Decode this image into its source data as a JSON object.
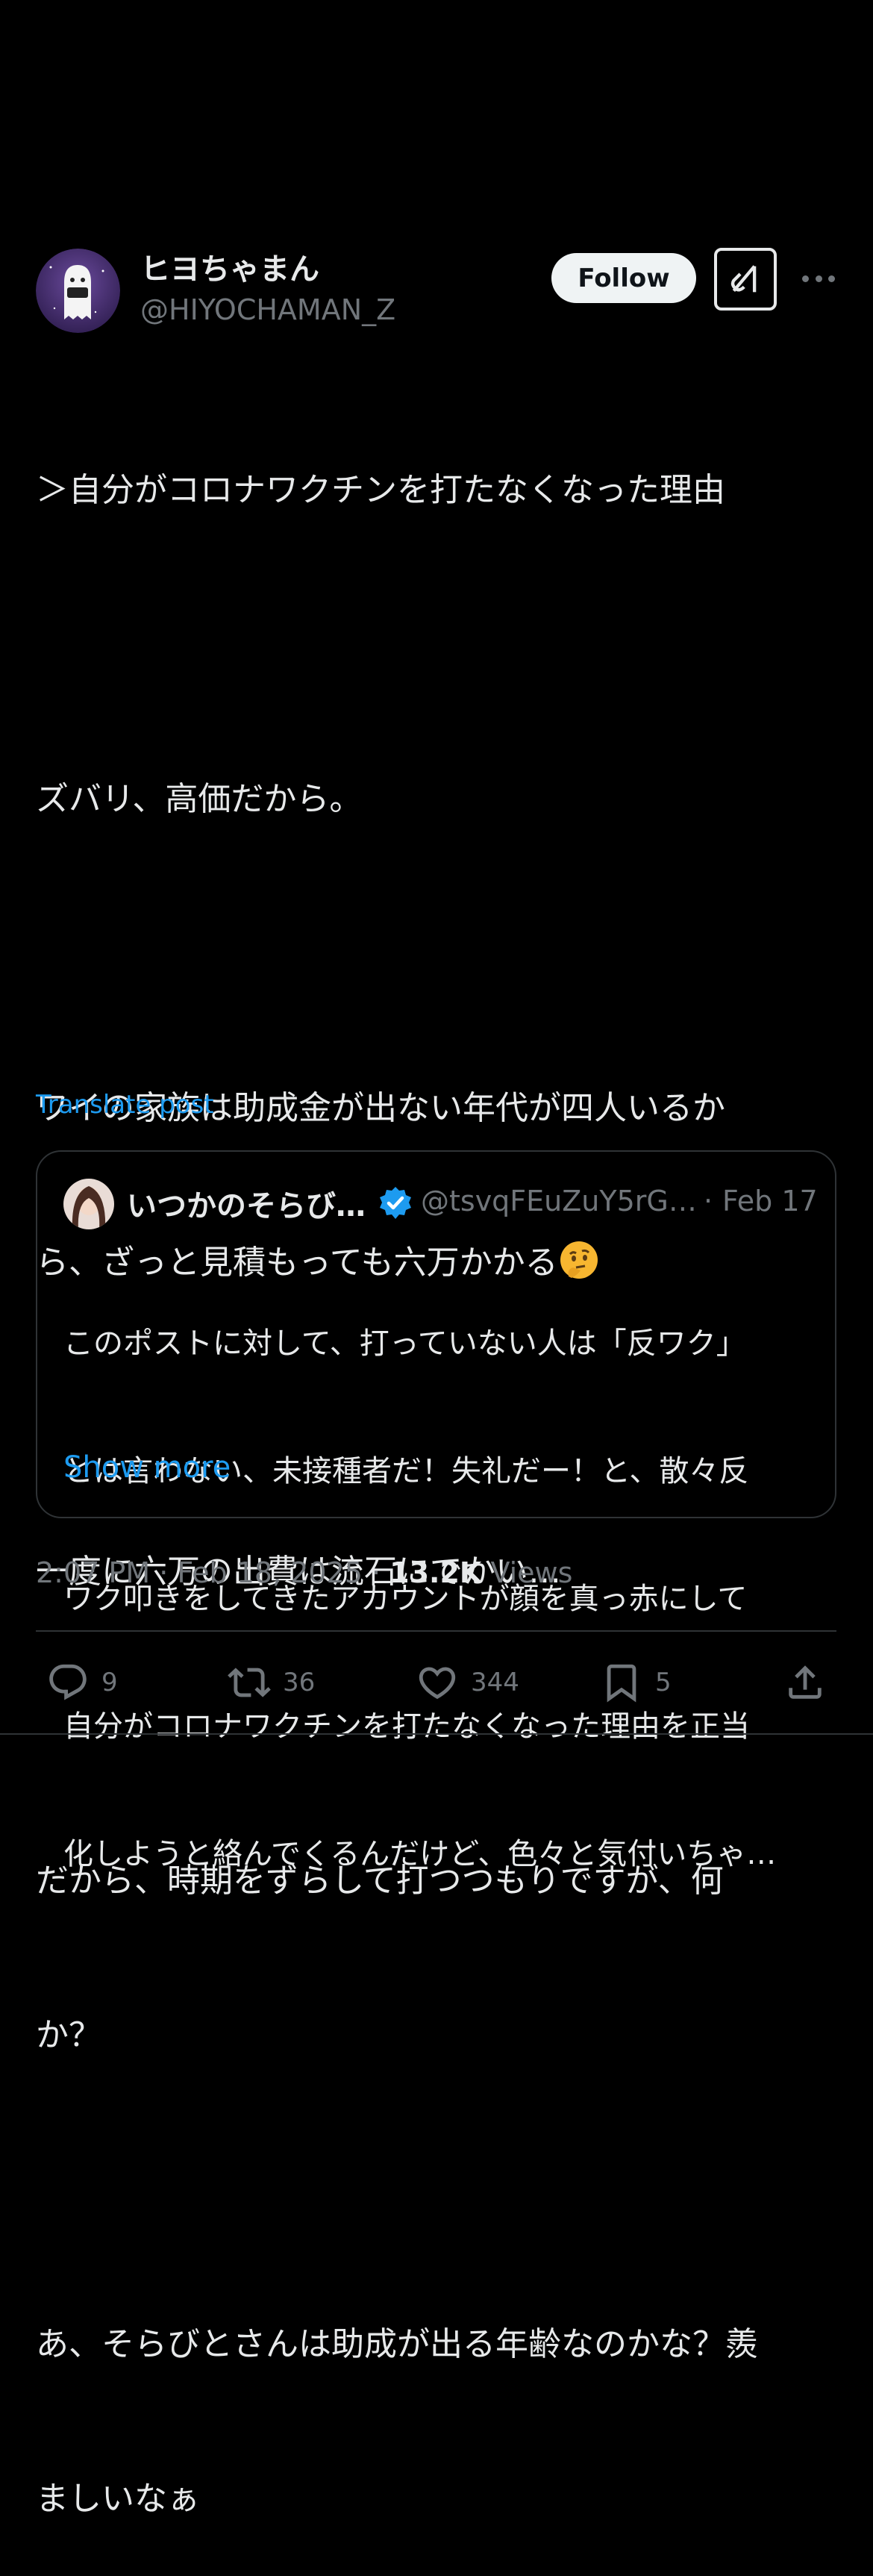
{
  "header": {
    "logo_icon": "x-logo-icon"
  },
  "author": {
    "display_name": "ヒヨちゃまん",
    "handle": "@HIYOCHAMAN_Z",
    "avatar_icon": "avatar-ghost-icon"
  },
  "actions_top": {
    "follow_label": "Follow",
    "grok_icon": "grok-icon",
    "more_icon": "more-icon"
  },
  "post": {
    "text_lines": [
      "＞自分がコロナワクチンを打たなくなった理由",
      "",
      "ズバリ、高価だから。",
      "",
      "ワイの家族は助成金が出ない年代が四人いるか",
      "ら、ざっと見積もっても六万かかる",
      "",
      "一度に六万の出費は流石にでかい…",
      "",
      "だから、時期をずらして打つつもりですが、何",
      "か？",
      "",
      "あ、そらびとさんは助成が出る年齢なのかな？羨",
      "ましいなぁ"
    ],
    "emoji_icon": "thinking-face-icon",
    "translate_label": "Translate post"
  },
  "quote": {
    "name": "いつかのそらび…",
    "verified_icon": "verified-badge-icon",
    "handle": "@tsvqFEuZuY5rG…",
    "separator": "·",
    "date": "Feb 17",
    "text_lines": [
      "このポストに対して、打っていない人は「反ワク」",
      "とは言わない、未接種者だ！失礼だー！と、散々反",
      "ワク叩きをしてきたアカウントが顔を真っ赤にして",
      "自分がコロナワクチンを打たなくなった理由を正当",
      "化しようと絡んでくるんだけど、色々と気付いちゃ…"
    ],
    "show_more_label": "Show more"
  },
  "meta": {
    "time_date": "2:07 PM · Feb 18, 2025 · ",
    "views_count": "13.2K",
    "views_label": " Views"
  },
  "actions": {
    "reply_count": "9",
    "repost_count": "36",
    "like_count": "344",
    "bookmark_count": "5"
  },
  "colors": {
    "background": "#000000",
    "text": "#e7e9ea",
    "secondary_text": "#71767b",
    "link": "#1d9bf0",
    "border": "#2f3336"
  }
}
